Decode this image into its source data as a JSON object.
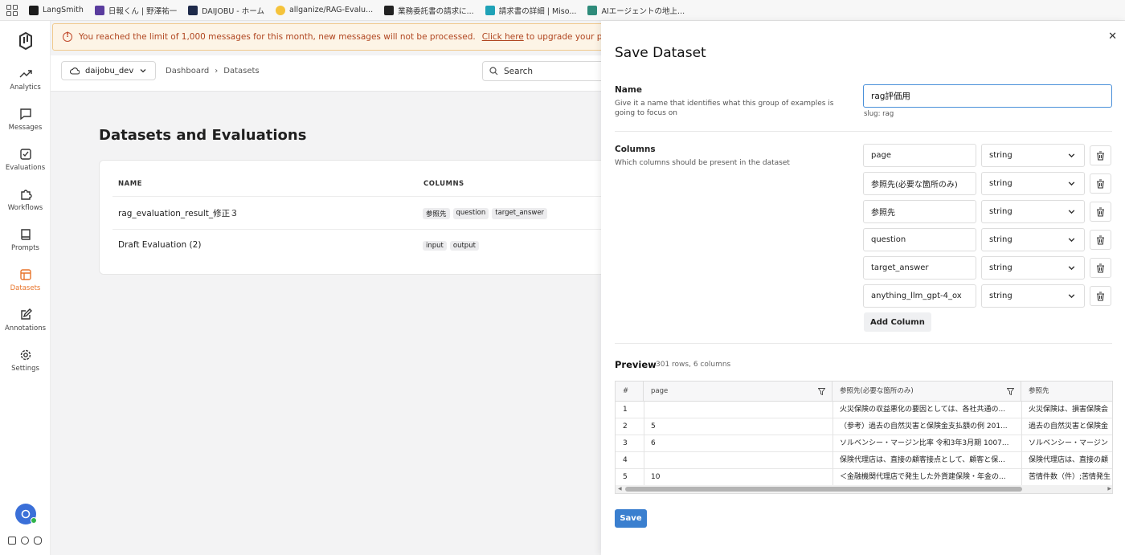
{
  "bookmarks": [
    {
      "label": "LangSmith",
      "color": "#1c1c1c"
    },
    {
      "label": "日報くん | 野澤祐一",
      "color": "#5a3c9e"
    },
    {
      "label": "DAIJOBU - ホーム",
      "color": "#1e2a4a"
    },
    {
      "label": "allganize/RAG-Evalu...",
      "color": "#f5c33b"
    },
    {
      "label": "業務委託書の請求に...",
      "color": "#222222"
    },
    {
      "label": "請求書の詳細 | Miso...",
      "color": "#1fa2b7"
    },
    {
      "label": "AIエージェントの地上...",
      "color": "#2e8b7a"
    }
  ],
  "nav": {
    "items": [
      {
        "label": "Analytics",
        "icon": "trending-up-icon"
      },
      {
        "label": "Messages",
        "icon": "message-square-icon"
      },
      {
        "label": "Evaluations",
        "icon": "check-square-icon"
      },
      {
        "label": "Workflows",
        "icon": "puzzle-icon"
      },
      {
        "label": "Prompts",
        "icon": "book-icon"
      },
      {
        "label": "Datasets",
        "icon": "table-icon",
        "active": true
      },
      {
        "label": "Annotations",
        "icon": "edit-icon"
      },
      {
        "label": "Settings",
        "icon": "gear-icon"
      }
    ],
    "active_color": "#e8742a"
  },
  "alert": {
    "text_before": "You reached the limit of 1,000 messages for this month, new messages will not be processed.",
    "link": "Click here",
    "text_after": "to upgrade your plan."
  },
  "topbar": {
    "project": "daijobu_dev",
    "breadcrumb": [
      "Dashboard",
      "Datasets"
    ],
    "search_placeholder": "Search"
  },
  "datasets_page": {
    "title": "Datasets and Evaluations",
    "headers": {
      "name": "NAME",
      "columns": "COLUMNS"
    },
    "rows": [
      {
        "name": "rag_evaluation_result_修正３",
        "columns": [
          "参照先",
          "question",
          "target_answer"
        ]
      },
      {
        "name": "Draft Evaluation (2)",
        "columns": [
          "input",
          "output"
        ]
      }
    ]
  },
  "drawer": {
    "title": "Save Dataset",
    "name_section": {
      "label": "Name",
      "description": "Give it a name that identifies what this group of examples is going to focus on",
      "value": "rag評価用",
      "slug": "slug: rag"
    },
    "columns_section": {
      "label": "Columns",
      "description": "Which columns should be present in the dataset",
      "columns": [
        {
          "name": "page",
          "type": "string"
        },
        {
          "name": "参照先(必要な箇所のみ)",
          "type": "string"
        },
        {
          "name": "参照先",
          "type": "string"
        },
        {
          "name": "question",
          "type": "string"
        },
        {
          "name": "target_answer",
          "type": "string"
        },
        {
          "name": "anything_llm_gpt-4_ox",
          "type": "string"
        }
      ],
      "add_label": "Add Column"
    },
    "preview": {
      "label": "Preview",
      "meta": "301 rows, 6 columns",
      "headers": [
        "#",
        "page",
        "参照先(必要な箇所のみ)",
        "参照先"
      ],
      "rows": [
        [
          "1",
          "",
          "火災保険の収益悪化の要因としては、各社共通の...",
          "火災保険は、損害保険会"
        ],
        [
          "2",
          "5",
          "（参考）過去の自然災害と保険金支払額の例 201...",
          "過去の自然災害と保険金"
        ],
        [
          "3",
          "6",
          "ソルベンシー・マージン比率 令和3年3月期 1007...",
          "ソルベンシー・マージン"
        ],
        [
          "4",
          "",
          "保険代理店は、直接の顧客接点として、顧客と保...",
          "保険代理店は、直接の顧"
        ],
        [
          "5",
          "10",
          "＜金融機関代理店で発生した外貨建保険・年金の...",
          "苦情件数（件）;苦情発生"
        ]
      ]
    },
    "save_label": "Save",
    "close_icon": "close-icon"
  },
  "colors": {
    "primary_button": "#3a7fcf",
    "alert_text": "#b0451f",
    "alert_bg": "#fdf4e6",
    "input_focus": "#4a90d9"
  }
}
